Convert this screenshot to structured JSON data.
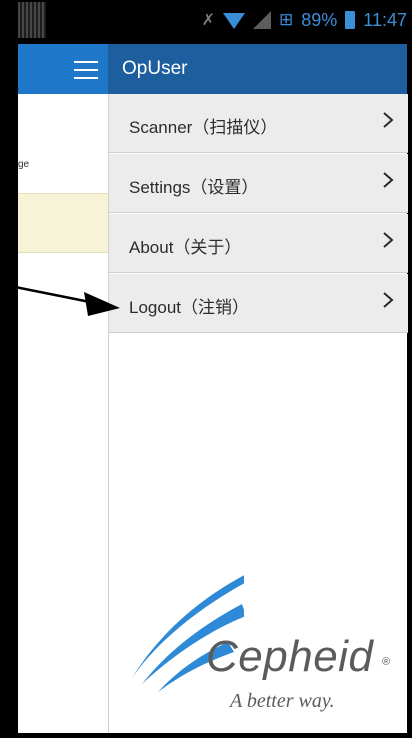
{
  "status_bar": {
    "battery": "89%",
    "time": "11:47"
  },
  "app": {
    "title": "OpUser"
  },
  "background": {
    "partial_text": "ge"
  },
  "menu": [
    {
      "label": "Scanner（扫描仪）"
    },
    {
      "label": "Settings（设置）"
    },
    {
      "label": "About（关于）"
    },
    {
      "label": "Logout（注销）"
    }
  ],
  "logo": {
    "word": "Cepheid",
    "registered": "®",
    "tagline": "A better way."
  },
  "colors": {
    "statusbar": "#000000",
    "appbar_left": "#1f77c9",
    "appbar_right": "#1d5f9e",
    "menu_bg": "#ececec",
    "status_accent": "#3b8ed8",
    "logo_blue": "#2e8ad6",
    "logo_gray": "#5b5b5b"
  },
  "icons": {
    "hamburger": "hamburger-icon",
    "chevron": "chevron-right-icon",
    "wifi": "wifi-icon",
    "signal": "signal-icon",
    "battery": "battery-icon",
    "mute": "mute-icon",
    "data": "data-icon"
  }
}
